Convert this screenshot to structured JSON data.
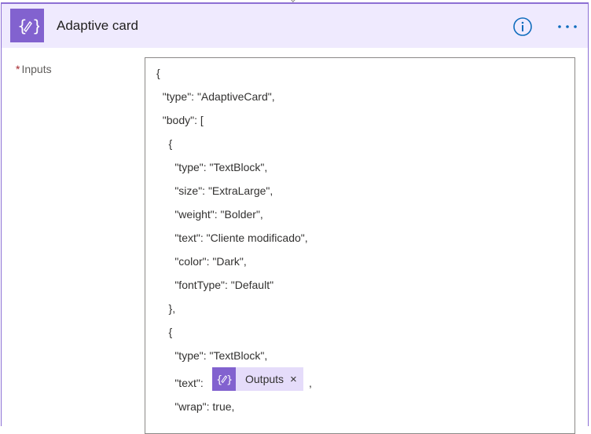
{
  "action": {
    "title": "Adaptive card",
    "icon": "curly-braces-pen-icon",
    "accent_color": "#8262cf",
    "header_bg": "#efeafe"
  },
  "inputs": {
    "required_marker": "*",
    "label": "Inputs"
  },
  "editor": {
    "lines": [
      "{",
      "  \"type\": \"AdaptiveCard\",",
      "  \"body\": [",
      "    {",
      "      \"type\": \"TextBlock\",",
      "      \"size\": \"ExtraLarge\",",
      "      \"weight\": \"Bolder\",",
      "      \"text\": \"Cliente modificado\",",
      "      \"color\": \"Dark\",",
      "      \"fontType\": \"Default\"",
      "    },",
      "    {",
      "      \"type\": \"TextBlock\",",
      "      \"text\": ",
      "      \"wrap\": true,"
    ],
    "token_line_suffix": ",",
    "token": {
      "label": "Outputs",
      "icon": "curly-braces-pen-icon",
      "close_icon": "close-icon"
    }
  }
}
